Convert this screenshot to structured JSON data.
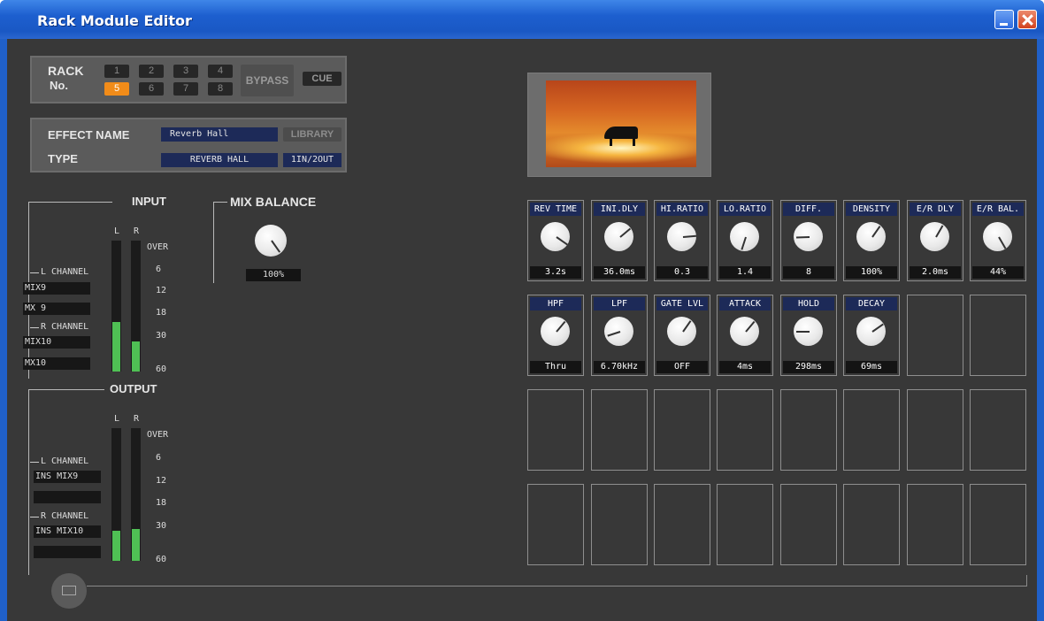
{
  "window": {
    "title": "Rack Module Editor"
  },
  "rack": {
    "label_line1": "RACK",
    "label_line2": "No.",
    "numbers": [
      "1",
      "2",
      "3",
      "4",
      "5",
      "6",
      "7",
      "8"
    ],
    "active": "5",
    "bypass": "BYPASS",
    "cue": "CUE"
  },
  "effect": {
    "name_label": "EFFECT NAME",
    "name_value": "Reverb Hall",
    "library": "LIBRARY",
    "type_label": "TYPE",
    "type_value": "REVERB HALL",
    "io": "1IN/2OUT"
  },
  "input": {
    "title": "INPUT",
    "l": "L",
    "r": "R",
    "l_channel_label": "L CHANNEL",
    "l_channel_1": "MIX9",
    "l_channel_2": "MX 9",
    "r_channel_label": "R CHANNEL",
    "r_channel_1": "MIX10",
    "r_channel_2": "MX10",
    "meter_l": 0.38,
    "meter_r": 0.23
  },
  "output": {
    "title": "OUTPUT",
    "l": "L",
    "r": "R",
    "l_channel_label": "L CHANNEL",
    "l_channel_1": "INS MIX9",
    "l_channel_2": "",
    "r_channel_label": "R CHANNEL",
    "r_channel_1": "INS MIX10",
    "r_channel_2": "",
    "meter_l": 0.23,
    "meter_r": 0.24
  },
  "meter_scale": [
    "OVER",
    "6",
    "12",
    "18",
    "30",
    "60"
  ],
  "mix_balance": {
    "title": "MIX BALANCE",
    "value": "100%"
  },
  "params_row1": [
    {
      "name": "REV TIME",
      "value": "3.2s"
    },
    {
      "name": "INI.DLY",
      "value": "36.0ms"
    },
    {
      "name": "HI.RATIO",
      "value": "0.3"
    },
    {
      "name": "LO.RATIO",
      "value": "1.4"
    },
    {
      "name": "DIFF.",
      "value": "8"
    },
    {
      "name": "DENSITY",
      "value": "100%"
    },
    {
      "name": "E/R DLY",
      "value": "2.0ms"
    },
    {
      "name": "E/R BAL.",
      "value": "44%"
    }
  ],
  "params_row2": [
    {
      "name": "HPF",
      "value": "Thru"
    },
    {
      "name": "LPF",
      "value": "6.70kHz"
    },
    {
      "name": "GATE LVL",
      "value": "OFF"
    },
    {
      "name": "ATTACK",
      "value": "4ms"
    },
    {
      "name": "HOLD",
      "value": "298ms"
    },
    {
      "name": "DECAY",
      "value": "69ms"
    }
  ]
}
